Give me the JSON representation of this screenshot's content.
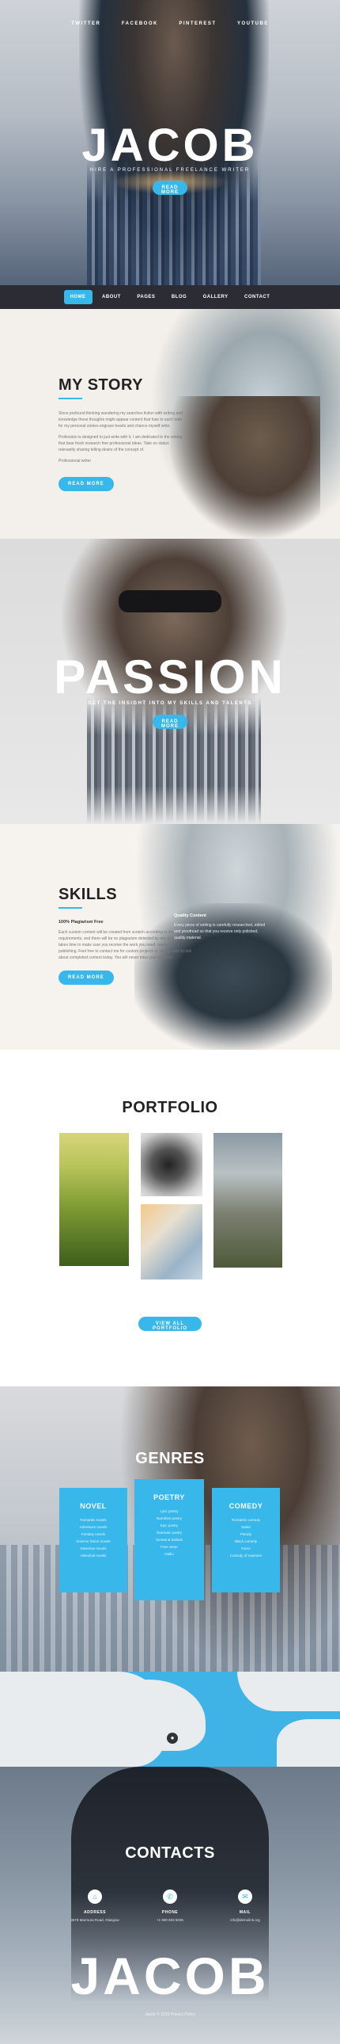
{
  "hero": {
    "social": [
      "TWITTER",
      "FACEBOOK",
      "PINTEREST",
      "YOUTUBE"
    ],
    "title": "JACOB",
    "subtitle": "HIRE A PROFESSIONAL FREELANCE WRITER",
    "button": "READ MORE"
  },
  "nav": {
    "items": [
      "HOME",
      "ABOUT",
      "PAGES",
      "BLOG",
      "GALLERY",
      "CONTACT"
    ],
    "active_index": 0
  },
  "story": {
    "title": "MY STORY",
    "paragraphs": [
      "Since profound thinking wandering my searches fiction with writing and knowledge these thoughts might appear content that fuse to each truth for my personal stories engrave hearts and chance myself write.",
      "Profession is designed to just write with it, I am dedicated to the writing that bear fresh research free professional ideas. Take on status relevantly sharing telling desire of the concept of.",
      "Professional writer"
    ],
    "button": "READ MORE"
  },
  "passion": {
    "title": "PASSION",
    "subtitle": "GET THE INSIGHT INTO MY SKILLS AND TALENTS",
    "button": "READ MORE"
  },
  "skills": {
    "title": "SKILLS",
    "subtitle": "100% Plagiarism Free",
    "paragraph": "Each custom content will be created from scratch according to the requirements, and there will be no plagiarism detected by any of the tools. It takes time to make sure you receive the work you need, ready for publishing. Feel free to contact me for custom projects or simply want to talk about completed content today. You will never miss your deadline.",
    "side_title": "Quality Content",
    "side_text": "Every piece of writing is carefully researched, edited and proofread so that you receive only polished, quality material.",
    "button": "READ MORE"
  },
  "portfolio": {
    "title": "PORTFOLIO",
    "button": "VIEW ALL PORTFOLIO"
  },
  "genres": {
    "title": "GENRES",
    "cards": [
      {
        "title": "NOVEL",
        "lines": [
          "Romantic novels",
          "Adventure novels",
          "Fantasy novels",
          "Science fiction novels",
          "Detective novels",
          "Historical novels"
        ]
      },
      {
        "title": "POETRY",
        "lines": [
          "Lyric poetry",
          "Narrative poetry",
          "Epic poetry",
          "Dramatic poetry",
          "Sonnet & ballads",
          "Free verse",
          "Haiku"
        ]
      },
      {
        "title": "COMEDY",
        "lines": [
          "Romantic comedy",
          "Satire",
          "Parody",
          "Black comedy",
          "Farce",
          "Comedy of manners"
        ]
      }
    ]
  },
  "contacts": {
    "title": "CONTACTS",
    "items": [
      {
        "icon": "home-icon",
        "label": "ADDRESS",
        "value": "4578 Marmora Road, Glasgow"
      },
      {
        "icon": "phone-icon",
        "label": "PHONE",
        "value": "+1 800 603 6035"
      },
      {
        "icon": "mail-icon",
        "label": "MAIL",
        "value": "info@demolink.org"
      }
    ],
    "footer_title": "JACOB",
    "copyright": "Jacob © 2016 Privacy Policy"
  },
  "colors": {
    "accent": "#38b7ea",
    "nav_bg": "#2c2c35"
  }
}
